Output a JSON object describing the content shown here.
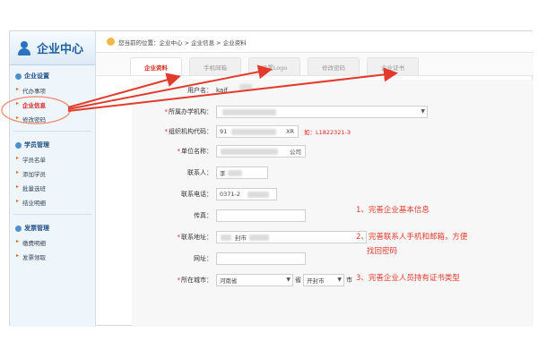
{
  "sidebar": {
    "title": "企业中心",
    "sections": [
      {
        "title": "企业设置",
        "items": [
          "代办事项",
          "企业信息",
          "修改密码"
        ]
      },
      {
        "title": "学员管理",
        "items": [
          "学员名单",
          "添加学员",
          "批量选班",
          "结业明细"
        ]
      },
      {
        "title": "发票管理",
        "items": [
          "缴费明细",
          "发票领取"
        ]
      }
    ]
  },
  "breadcrumb": "您当前的位置：企业中心 > 企业信息 > 企业资料",
  "tabs": [
    "企业资料",
    "手机邮箱",
    "设置Logo",
    "修改密码",
    "企业证书"
  ],
  "form": {
    "username_label": "用户名：",
    "username_value": "kaif",
    "school_label": "所属办学机构：",
    "org_code_label": "组织机构代码：",
    "org_code_prefix": "91",
    "org_code_suffix": "XR",
    "org_code_hint": "如：L1822321-3",
    "company_label": "单位名称：",
    "company_suffix": "公司",
    "contact_label": "联系人：",
    "contact_value": "李",
    "phone_label": "联系电话：",
    "phone_value": "0371-2",
    "fax_label": "传真：",
    "address_label": "联系地址：",
    "address_value": "封市",
    "website_label": "网址：",
    "city_label": "所在城市：",
    "province_value": "河南省",
    "province_unit": "省",
    "city_value": "开封市",
    "city_unit": "市"
  },
  "tips": [
    "1、完善企业基本信息",
    "2、完善联系人手机和邮箱，方便",
    "找回密码",
    "3、完善企业人员持有证书类型"
  ],
  "colors": {
    "accent_red": "#e23b2b",
    "brand_blue": "#1f5e9e"
  }
}
